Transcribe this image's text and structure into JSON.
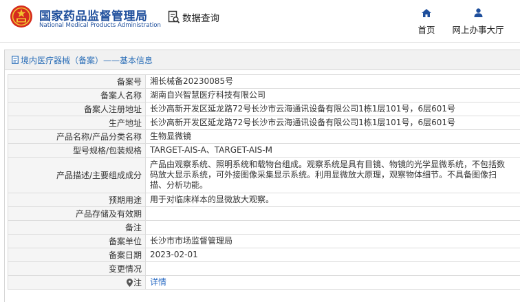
{
  "header": {
    "org_name_cn": "国家药品监督管理局",
    "org_name_en": "National Medical Products Administration",
    "query_label": "数据查询",
    "nav": {
      "home": "首页",
      "hall": "网上办事大厅"
    }
  },
  "panel": {
    "title": "境内医疗器械（备案）——基本信息"
  },
  "record": {
    "rows": [
      {
        "label": "备案号",
        "value": "湘长械备20230085号"
      },
      {
        "label": "备案人名称",
        "value": "湖南自兴智慧医疗科技有限公司"
      },
      {
        "label": "备案人注册地址",
        "value": "长沙高新开发区延龙路72号长沙市云海通讯设备有限公司1栋1层101号，6层601号"
      },
      {
        "label": "生产地址",
        "value": "长沙高新开发区延龙路72号长沙市云海通讯设备有限公司1栋1层101号，6层601号"
      },
      {
        "label": "产品名称/产品分类名称",
        "value": "生物显微镜"
      },
      {
        "label": "型号规格/包装规格",
        "value": "TARGET-AIS-A、TARGET-AIS-M"
      },
      {
        "label": "产品描述/主要组成成分",
        "value": "产品由观察系统、照明系统和载物台组成。观察系统是具有目镜、物镜的光学显微系统，不包括数码放大显示系统，可外接图像采集显示系统。利用显微放大原理，观察物体细节。不具备图像扫描、分析功能。"
      },
      {
        "label": "预期用途",
        "value": "用于对临床样本的显微放大观察。"
      },
      {
        "label": "产品存储及有效期",
        "value": ""
      },
      {
        "label": "备注",
        "value": ""
      },
      {
        "label": "备案单位",
        "value": "长沙市市场监督管理局"
      },
      {
        "label": "备案日期",
        "value": "2023-02-01"
      },
      {
        "label": "变更情况",
        "value": ""
      }
    ],
    "note_label": "注",
    "note_link": "详情"
  },
  "colors": {
    "brand_blue": "#1f4f9c",
    "emblem_red": "#d62b1e",
    "link_blue": "#2b6cc4",
    "label_bg": "#f5f5f5"
  },
  "icons": [
    "national-emblem-icon",
    "search-document-icon",
    "home-icon",
    "user-icon",
    "document-icon",
    "location-pin-icon"
  ]
}
